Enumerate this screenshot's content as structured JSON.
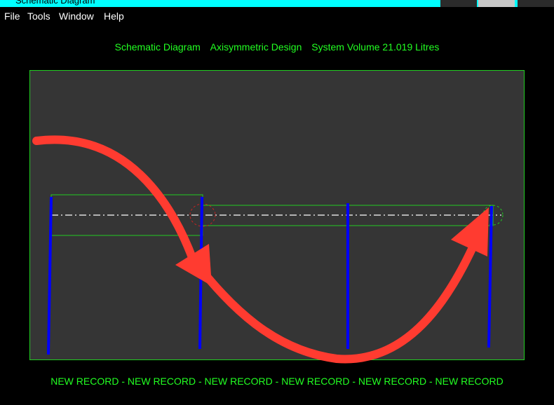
{
  "window": {
    "title": "Schematic Diagram"
  },
  "menu": {
    "file": "File",
    "tools": "Tools",
    "window": "Window",
    "help": "Help"
  },
  "header": {
    "part1": "Schematic Diagram",
    "part2": "Axisymmetric Design",
    "part3": "System Volume 21.019 Litres"
  },
  "footer": {
    "text": "NEW RECORD - NEW RECORD - NEW RECORD - NEW RECORD - NEW RECORD - NEW RECORD"
  },
  "colors": {
    "menu_text": "#ffffff",
    "header_text": "#22ff22",
    "frame_border": "#22cc22",
    "panel_bg": "#353535",
    "baffle": "#0000ff",
    "arrow": "#ff3b30",
    "centerline": "#ffffff",
    "marker_red": "#cc2222",
    "marker_green": "#22cc22"
  }
}
